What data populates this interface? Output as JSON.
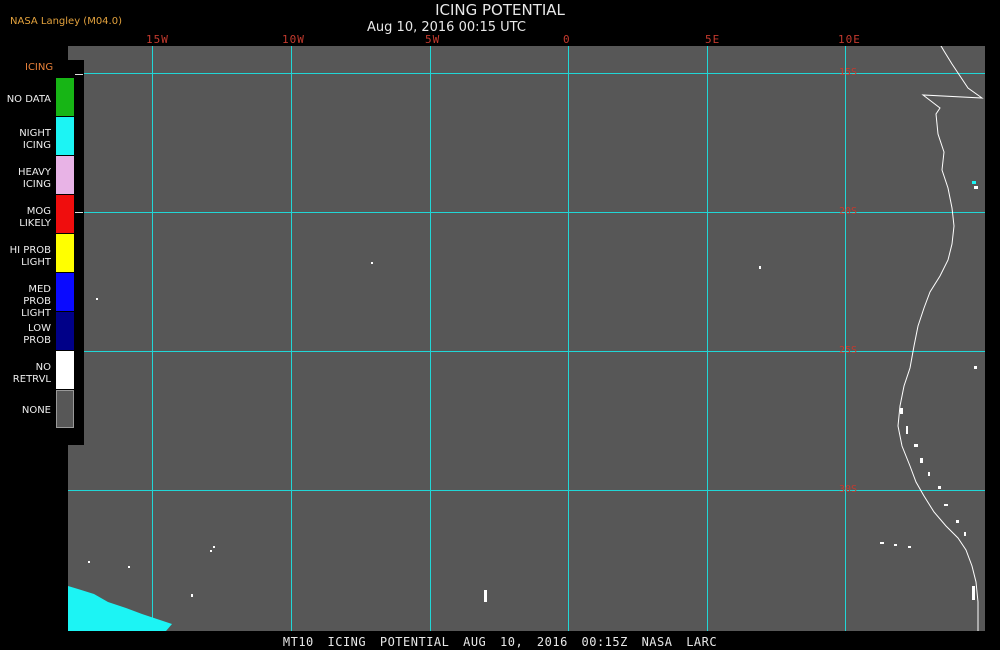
{
  "header": {
    "title": "ICING POTENTIAL",
    "subtitle": "Aug 10, 2016 00:15 UTC",
    "credit": "NASA Langley (M04.0)"
  },
  "footer": {
    "text": "MT10  ICING POTENTIAL  AUG 10, 2016 00:15Z  NASA LARC"
  },
  "grid": {
    "longitude_labels": [
      "15W",
      "10W",
      "5W",
      "0",
      "5E",
      "10E"
    ],
    "latitude_labels": [
      "15S",
      "20S",
      "25S",
      "30S"
    ]
  },
  "legend": {
    "title": "ICING",
    "items": [
      {
        "label": "NO DATA",
        "color": "#17b515"
      },
      {
        "label": "NIGHT ICING",
        "color": "#1cf4f4"
      },
      {
        "label": "HEAVY ICING",
        "color": "#e8b3e6"
      },
      {
        "label": "MOG LIKELY",
        "color": "#f00d0d"
      },
      {
        "label": "HI PROB LIGHT",
        "color": "#ffff00"
      },
      {
        "label": "MED PROB LIGHT",
        "color": "#0a0aff"
      },
      {
        "label": "LOW PROB",
        "color": "#000088"
      },
      {
        "label": "NO RETRVL",
        "color": "#ffffff"
      },
      {
        "label": "NONE",
        "color": "#575757"
      }
    ]
  },
  "colors": {
    "background": "#575757",
    "grid": "#21d6d6",
    "coastline": "#ffffff",
    "grid_labels": "#c43a2e"
  }
}
